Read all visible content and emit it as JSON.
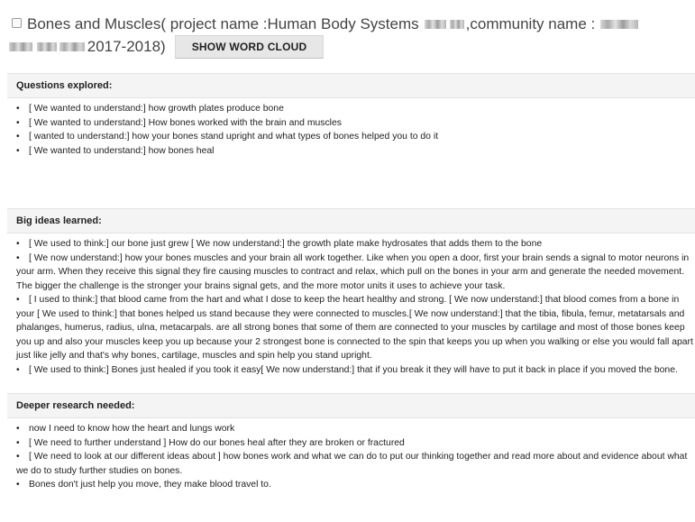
{
  "header": {
    "title_part1": "Bones and Muscles( project name :Human Body Systems",
    "title_part2": ",community name :",
    "title_part3": "2017-2018)",
    "word_cloud_button": "SHOW WORD CLOUD"
  },
  "sections": [
    {
      "title": "Questions explored:",
      "items": [
        "[ We wanted to understand:] how growth plates produce bone",
        "[ We wanted to understand:] How bones worked with the brain and muscles",
        "[ wanted to understand:] how your bones stand upright and what types of bones helped you to do it",
        "[ We wanted to understand:] how bones heal"
      ]
    },
    {
      "title": "Big ideas learned:",
      "items": [
        "[ We used to think:] our bone just grew [ We now understand:] the growth plate make hydrosates that adds them to the bone",
        "[ We now understand:] how your bones muscles and your brain all work together. Like when you open a door, first your brain sends a signal to motor neurons in your arm. When they receive this signal they fire causing muscles to contract and relax, which pull on the bones in your arm and generate the needed movement. The bigger the challenge is the stronger your brains signal gets, and the more motor units it uses to achieve your task.",
        "[ I used to think:] that blood came from the hart and what I dose to keep the heart healthy and strong. [ We now understand:] that blood comes from a bone in your [ We used to think:] that bones helped us stand because they were connected to muscles.[ We now understand:] that the tibia, fibula, femur, metatarsals and phalanges, humerus, radius, ulna, metacarpals. are all strong bones that some of them are connected to your muscles by cartilage and most of those bones keep you up and also your muscles keep you up because your 2 strongest bone is connected to the spin that keeps you up when you walking or else you would fall apart just like jelly and that's why bones, cartilage, muscles and spin help you stand upright.",
        "[ We used to think:] Bones just healed if you took it easy[ We now understand:] that if you break it they will have to put it back in place if you moved the bone."
      ]
    },
    {
      "title": "Deeper research needed:",
      "items": [
        "now I need to know how the heart and lungs work",
        "[ We need to further understand ] How do our bones heal after they are broken or fractured",
        "[ We need to look at our different ideas about ] how bones work and what we can do to put our thinking together and read more about and evidence about what we do to study further studies on bones.",
        "Bones don't just help you move, they make blood travel to."
      ]
    }
  ]
}
